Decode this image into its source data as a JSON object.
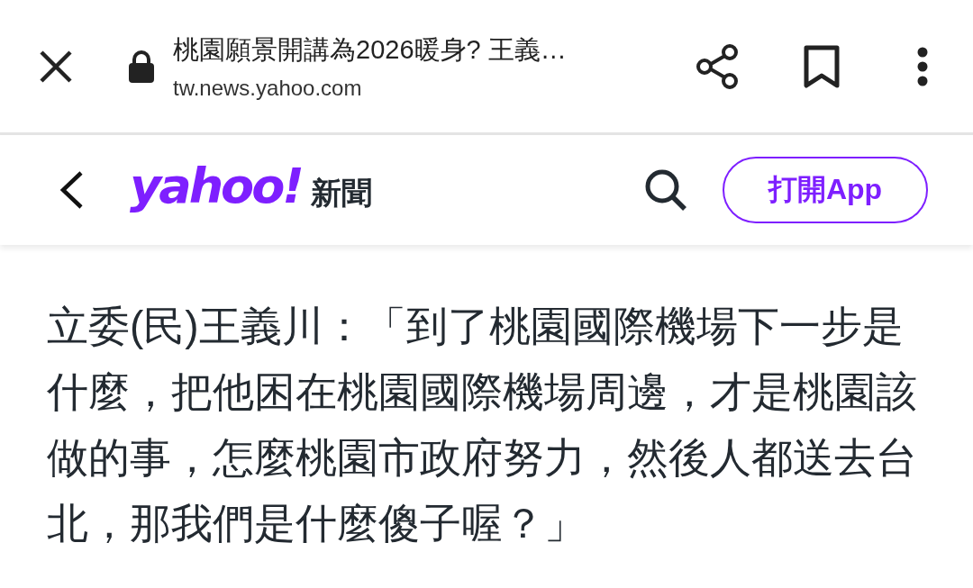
{
  "browser_bar": {
    "page_title": "桃園願景開講為2026暖身? 王義…",
    "url": "tw.news.yahoo.com"
  },
  "site_header": {
    "logo": "yahoo!",
    "section": "新聞",
    "open_app_button": "打開App"
  },
  "article": {
    "paragraph": "立委(民)王義川：「到了桃園國際機場下一步是什麼，把他困在桃園國際機場周邊，才是桃園該做的事，怎麼桃園市政府努力，然後人都送去台北，那我們是什麼傻子喔？」"
  }
}
